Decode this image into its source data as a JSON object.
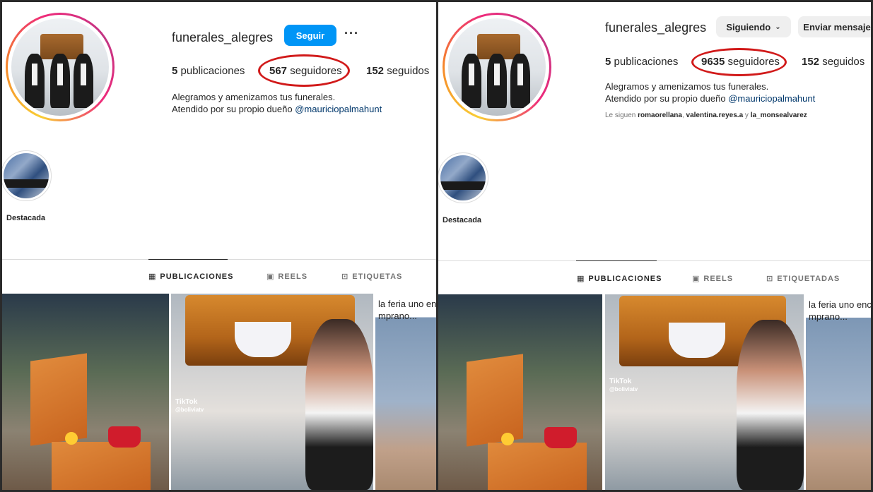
{
  "left": {
    "username": "funerales_alegres",
    "follow_button": "Seguir",
    "more_icon": "···",
    "stats": {
      "posts_num": "5",
      "posts_label": "publicaciones",
      "followers_num": "567",
      "followers_label": "seguidores",
      "following_num": "152",
      "following_label": "seguidos"
    },
    "bio_line1": "Alegramos y amenizamos tus funerales.",
    "bio_line2_prefix": "Atendido por su propio dueño",
    "bio_mention": "@mauriciopalmahunt",
    "highlight_label": "Destacada",
    "tabs": [
      "PUBLICACIONES",
      "REELS",
      "ETIQUETAS"
    ],
    "post3_caption_1": "la feria uno en",
    "post3_caption_2": "mprano...",
    "tiktok_label": "TikTok",
    "tiktok_handle": "@boliviatv"
  },
  "right": {
    "username": "funerales_alegres",
    "following_button": "Siguiendo",
    "message_button": "Enviar mensaje",
    "stats": {
      "posts_num": "5",
      "posts_label": "publicaciones",
      "followers_num": "9635",
      "followers_label": "seguidores",
      "following_num": "152",
      "following_label": "seguidos"
    },
    "bio_line1": "Alegramos y amenizamos tus funerales.",
    "bio_line2_prefix": "Atendido por su propio dueño",
    "bio_mention": "@mauriciopalmahunt",
    "followed_by_prefix": "Le siguen",
    "followed_by_1": "romaorellana",
    "followed_by_2": "valentina.reyes.a",
    "followed_by_and": "y",
    "followed_by_3": "la_monsealvarez",
    "highlight_label": "Destacada",
    "tabs": [
      "PUBLICACIONES",
      "REELS",
      "ETIQUETADAS"
    ],
    "post3_caption_1": "la feria uno enc",
    "post3_caption_2": "mprano...",
    "tiktok_label": "TikTok",
    "tiktok_handle": "@boliviatv"
  },
  "colors": {
    "accent_blue": "#0095f6",
    "annotation_red": "#d11a1a",
    "mention": "#00376b"
  }
}
